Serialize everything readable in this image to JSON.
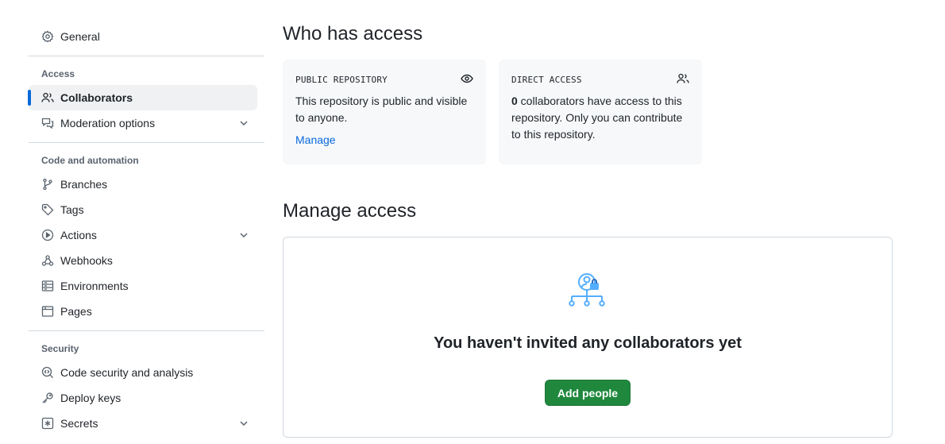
{
  "sidebar": {
    "general": {
      "label": "General",
      "icon": "gear-icon"
    },
    "access": {
      "title": "Access",
      "items": [
        {
          "label": "Collaborators",
          "icon": "people-icon",
          "active": true
        },
        {
          "label": "Moderation options",
          "icon": "comment-discussion-icon",
          "expandable": true
        }
      ]
    },
    "code_automation": {
      "title": "Code and automation",
      "items": [
        {
          "label": "Branches",
          "icon": "git-branch-icon"
        },
        {
          "label": "Tags",
          "icon": "tag-icon"
        },
        {
          "label": "Actions",
          "icon": "play-icon",
          "expandable": true
        },
        {
          "label": "Webhooks",
          "icon": "webhook-icon"
        },
        {
          "label": "Environments",
          "icon": "server-icon"
        },
        {
          "label": "Pages",
          "icon": "browser-icon"
        }
      ]
    },
    "security": {
      "title": "Security",
      "items": [
        {
          "label": "Code security and analysis",
          "icon": "codescan-icon"
        },
        {
          "label": "Deploy keys",
          "icon": "key-icon"
        },
        {
          "label": "Secrets",
          "icon": "key-asterisk-icon",
          "expandable": true
        }
      ]
    }
  },
  "main": {
    "who_has_access": {
      "heading": "Who has access",
      "public_card": {
        "title": "PUBLIC REPOSITORY",
        "icon": "eye-icon",
        "text": "This repository is public and visible to anyone.",
        "link": "Manage"
      },
      "direct_card": {
        "title": "DIRECT ACCESS",
        "icon": "people-icon",
        "count": "0",
        "text": " collaborators have access to this repository. Only you can contribute to this repository."
      }
    },
    "manage_access": {
      "heading": "Manage access",
      "empty_title": "You haven't invited any collaborators yet",
      "empty_icon": "person-lock-network-icon",
      "button": "Add people"
    }
  },
  "colors": {
    "accent": "#0969da",
    "button_green": "#1f883d",
    "muted": "#59636e",
    "icon_blue": "#54aeff"
  }
}
